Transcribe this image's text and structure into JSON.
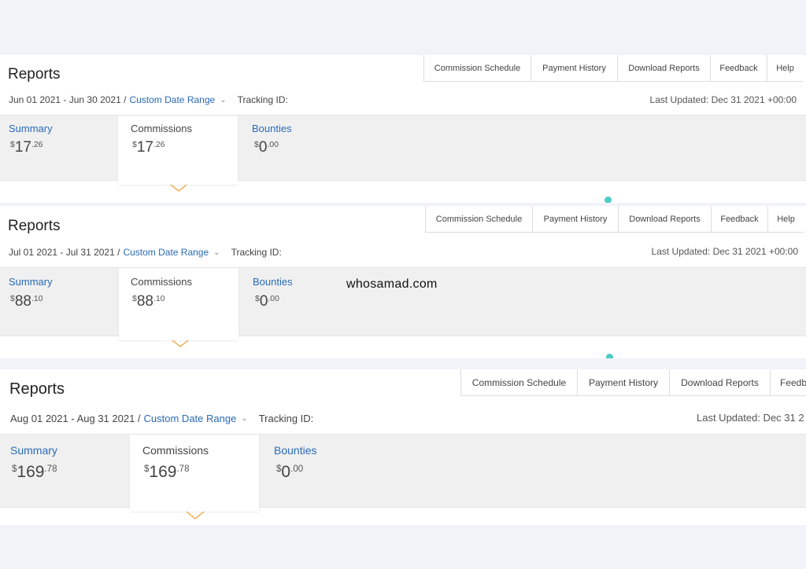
{
  "panels": [
    {
      "title": "Reports",
      "tabs": [
        "Commission Schedule",
        "Payment History",
        "Download Reports",
        "Feedback",
        "Help"
      ],
      "date_range": "Jun 01 2021 - Jun 30 2021 /",
      "range_link": "Custom Date Range",
      "tracking_label": "Tracking ID:",
      "last_updated": "Last Updated: Dec 31 2021 +00:00",
      "cards": [
        {
          "label": "Summary",
          "currency": "$",
          "whole": "17",
          "cents": ".26"
        },
        {
          "label": "Commissions",
          "currency": "$",
          "whole": "17",
          "cents": ".26"
        },
        {
          "label": "Bounties",
          "currency": "$",
          "whole": "0",
          "cents": ".00"
        }
      ]
    },
    {
      "title": "Reports",
      "tabs": [
        "Commission Schedule",
        "Payment History",
        "Download Reports",
        "Feedback",
        "Help"
      ],
      "date_range": "Jul 01 2021 - Jul 31 2021 /",
      "range_link": "Custom Date Range",
      "tracking_label": "Tracking ID:",
      "last_updated": "Last Updated: Dec 31 2021 +00:00",
      "cards": [
        {
          "label": "Summary",
          "currency": "$",
          "whole": "88",
          "cents": ".10"
        },
        {
          "label": "Commissions",
          "currency": "$",
          "whole": "88",
          "cents": ".10"
        },
        {
          "label": "Bounties",
          "currency": "$",
          "whole": "0",
          "cents": ".00"
        }
      ]
    },
    {
      "title": "Reports",
      "tabs": [
        "Commission Schedule",
        "Payment History",
        "Download Reports",
        "Feedb"
      ],
      "date_range": "Aug 01 2021 - Aug 31 2021 /",
      "range_link": "Custom Date Range",
      "tracking_label": "Tracking ID:",
      "last_updated": "Last Updated: Dec 31 2",
      "cards": [
        {
          "label": "Summary",
          "currency": "$",
          "whole": "169",
          "cents": ".78"
        },
        {
          "label": "Commissions",
          "currency": "$",
          "whole": "169",
          "cents": ".78"
        },
        {
          "label": "Bounties",
          "currency": "$",
          "whole": "0",
          "cents": ".00"
        }
      ]
    }
  ],
  "watermark": "whosamad.com",
  "colors": {
    "link": "#2a6ab7",
    "caret": "#f5b05a",
    "legend_dot": "#4ecdc4",
    "page_bg": "#f1f3f8"
  }
}
